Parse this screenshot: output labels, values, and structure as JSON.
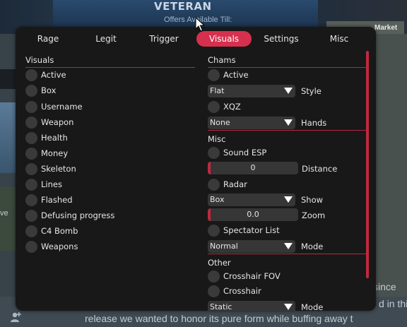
{
  "background": {
    "banner_title": "VETERAN",
    "offers_text": "Offers Available Till:",
    "market_label": "Market",
    "side_text": "ve",
    "article_line1": "since",
    "article_line2": "d in thi",
    "article_line3": "release we wanted to honor its pure form while buffing away t"
  },
  "tabs": [
    {
      "label": "Rage"
    },
    {
      "label": "Legit"
    },
    {
      "label": "Trigger"
    },
    {
      "label": "Visuals"
    },
    {
      "label": "Settings"
    },
    {
      "label": "Misc"
    }
  ],
  "active_tab": "Visuals",
  "accent_color": "#d6304f",
  "visuals": {
    "title": "Visuals",
    "items": [
      "Active",
      "Box",
      "Username",
      "Weapon",
      "Health",
      "Money",
      "Skeleton",
      "Lines",
      "Flashed",
      "Defusing progress",
      "C4 Bomb",
      "Weapons"
    ]
  },
  "chams": {
    "title": "Chams",
    "active_label": "Active",
    "style_value": "Flat",
    "style_label": "Style",
    "xqz_label": "XQZ",
    "hands_value": "None",
    "hands_label": "Hands"
  },
  "misc": {
    "title": "Misc",
    "sound_esp_label": "Sound ESP",
    "distance_value": "0",
    "distance_label": "Distance",
    "radar_label": "Radar",
    "show_value": "Box",
    "show_label": "Show",
    "zoom_value": "0.0",
    "zoom_label": "Zoom",
    "spectator_label": "Spectator List",
    "mode_value": "Normal",
    "mode_label": "Mode"
  },
  "other": {
    "title": "Other",
    "crosshair_fov_label": "Crosshair FOV",
    "crosshair_label": "Crosshair",
    "mode_value": "Static",
    "mode_label": "Mode"
  }
}
